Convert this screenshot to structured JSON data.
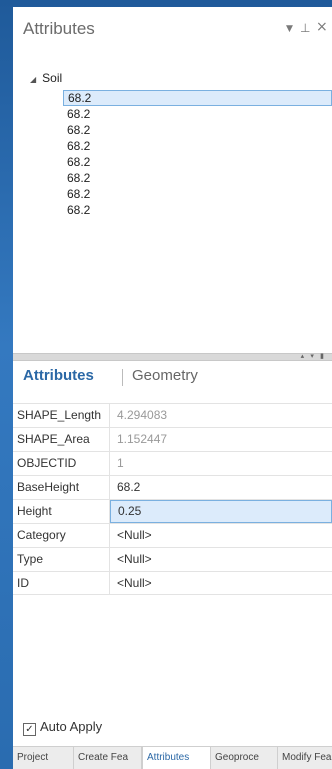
{
  "window": {
    "title": "Attributes",
    "buttons": {
      "menu": "▼",
      "pin": "⊥",
      "close": "×"
    }
  },
  "tree": {
    "layer": "Soil",
    "items": [
      "68.2",
      "68.2",
      "68.2",
      "68.2",
      "68.2",
      "68.2",
      "68.2",
      "68.2"
    ],
    "selected_index": 0
  },
  "splitter": {
    "controls": "▴ ▾ ▮"
  },
  "detail_tabs": {
    "active": "Attributes",
    "inactive": "Geometry"
  },
  "fields": [
    {
      "name": "SHAPE_Length",
      "value": "4.294083"
    },
    {
      "name": "SHAPE_Area",
      "value": "1.152447"
    },
    {
      "name": "OBJECTID",
      "value": "1"
    },
    {
      "name": "BaseHeight",
      "value": "68.2"
    },
    {
      "name": "Height",
      "value": "0.25"
    },
    {
      "name": "Category",
      "value": "<Null>"
    },
    {
      "name": "Type",
      "value": "<Null>"
    },
    {
      "name": "ID",
      "value": "<Null>"
    }
  ],
  "auto_apply": {
    "label": "Auto Apply",
    "checked": true
  },
  "bottom_tabs": [
    "Project",
    "Create Fea",
    "Attributes",
    "Geoproce",
    "Modify Fea"
  ],
  "colors": {
    "accent": "#2b68a6",
    "selection": "#dcebfb",
    "background_blue": "#2a6cb0"
  }
}
